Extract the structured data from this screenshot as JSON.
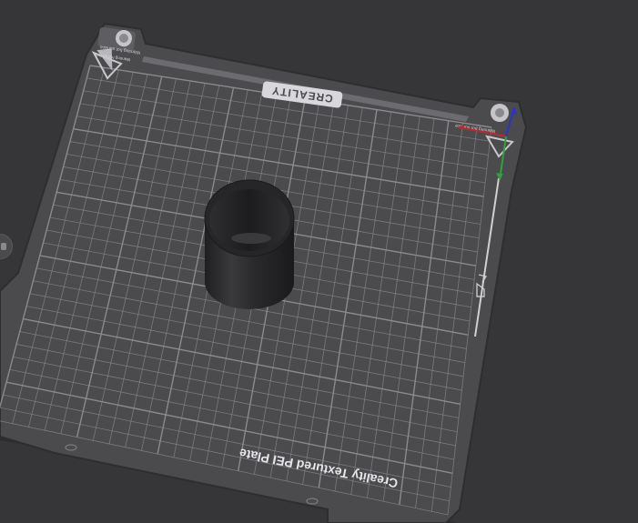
{
  "viewport": {
    "background_color": "#363638"
  },
  "build_plate": {
    "brand_label": "CREALITY",
    "plate_label": "Creality Textured PEI Plate",
    "warning_label_left": "Warning hot surface",
    "warning_label_right": "Warning hot surface",
    "plate_color": "#4b4b4d",
    "grid_color": "#8e8e92",
    "edge_color": "#2e2e30"
  },
  "axis_gizmo": {
    "x_color": "#c0262d",
    "y_color": "#2fa23c",
    "z_color": "#2a35c8"
  },
  "model": {
    "name": "cylinder-object",
    "color": "#2b2b2d"
  },
  "side_handle": {
    "icon": "collapse-handle-icon"
  },
  "plate_edge_marker": {
    "icon": "home-marker-icon"
  }
}
